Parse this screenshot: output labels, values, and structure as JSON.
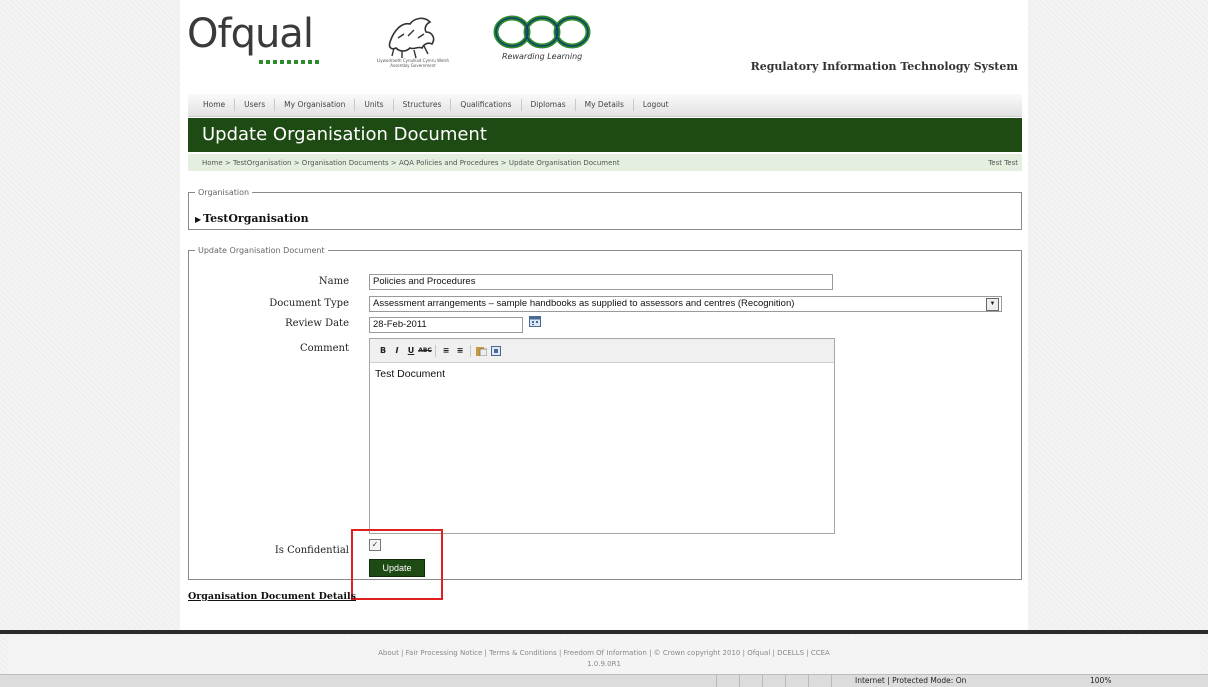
{
  "header": {
    "logo_ofqual": "Ofqual",
    "logo_wales_text": "Llywodraeth Cynulliad Cymru Welsh Assembly Government",
    "logo_ccea_tagline": "Rewarding Learning",
    "system_title": "Regulatory Information Technology System"
  },
  "nav": {
    "items": [
      "Home",
      "Users",
      "My Organisation",
      "Units",
      "Structures",
      "Qualifications",
      "Diplomas",
      "My Details",
      "Logout"
    ]
  },
  "page": {
    "title": "Update Organisation Document",
    "breadcrumb": "Home > TestOrganisation > Organisation Documents > AQA Policies and Procedures > Update Organisation Document",
    "user": "Test Test"
  },
  "organisation": {
    "legend": "Organisation",
    "name": "TestOrganisation"
  },
  "form": {
    "legend": "Update Organisation Document",
    "name_label": "Name",
    "name_value": "Policies and Procedures",
    "doctype_label": "Document Type",
    "doctype_value": "Assessment arrangements – sample handbooks as supplied to assessors and centres (Recognition)",
    "review_label": "Review Date",
    "review_value": "28-Feb-2011",
    "comment_label": "Comment",
    "comment_value": "Test Document",
    "confidential_label": "Is Confidential",
    "confidential_checked": true,
    "update_button": "Update"
  },
  "details_link": "Organisation Document Details",
  "footer": {
    "links": "About | Fair Processing Notice | Terms & Conditions | Freedom Of Information | © Crown copyright 2010 | Ofqual | DCELLS | CCEA",
    "version": "1.0.9.0R1"
  },
  "statusbar": {
    "mode": "Internet | Protected Mode: On",
    "zoom": "100%"
  },
  "colors": {
    "brand_green": "#1e4a13",
    "highlight_red": "#e02020"
  }
}
